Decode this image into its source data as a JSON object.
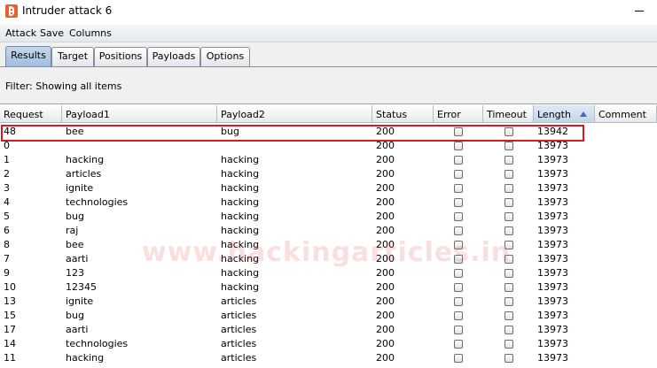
{
  "window": {
    "title": "Intruder attack 6"
  },
  "menu": [
    {
      "label": "Attack"
    },
    {
      "label": "Save"
    },
    {
      "label": "Columns"
    }
  ],
  "tabs": [
    {
      "label": "Results",
      "active": true
    },
    {
      "label": "Target",
      "active": false
    },
    {
      "label": "Positions",
      "active": false
    },
    {
      "label": "Payloads",
      "active": false
    },
    {
      "label": "Options",
      "active": false
    }
  ],
  "filter": {
    "text": "Filter:  Showing all items"
  },
  "table": {
    "columns": [
      "Request",
      "Payload1",
      "Payload2",
      "Status",
      "Error",
      "Timeout",
      "Length",
      "Comment"
    ],
    "sorted_column": "Length",
    "sort_direction": "ascending",
    "rows": [
      {
        "request": "48",
        "payload1": "bee",
        "payload2": "bug",
        "status": "200",
        "error": false,
        "timeout": false,
        "length": "13942",
        "comment": ""
      },
      {
        "request": "0",
        "payload1": "",
        "payload2": "",
        "status": "200",
        "error": false,
        "timeout": false,
        "length": "13973",
        "comment": ""
      },
      {
        "request": "1",
        "payload1": "hacking",
        "payload2": "hacking",
        "status": "200",
        "error": false,
        "timeout": false,
        "length": "13973",
        "comment": ""
      },
      {
        "request": "2",
        "payload1": "articles",
        "payload2": "hacking",
        "status": "200",
        "error": false,
        "timeout": false,
        "length": "13973",
        "comment": ""
      },
      {
        "request": "3",
        "payload1": "ignite",
        "payload2": "hacking",
        "status": "200",
        "error": false,
        "timeout": false,
        "length": "13973",
        "comment": ""
      },
      {
        "request": "4",
        "payload1": "technologies",
        "payload2": "hacking",
        "status": "200",
        "error": false,
        "timeout": false,
        "length": "13973",
        "comment": ""
      },
      {
        "request": "5",
        "payload1": "bug",
        "payload2": "hacking",
        "status": "200",
        "error": false,
        "timeout": false,
        "length": "13973",
        "comment": ""
      },
      {
        "request": "6",
        "payload1": "raj",
        "payload2": "hacking",
        "status": "200",
        "error": false,
        "timeout": false,
        "length": "13973",
        "comment": ""
      },
      {
        "request": "8",
        "payload1": "bee",
        "payload2": "hacking",
        "status": "200",
        "error": false,
        "timeout": false,
        "length": "13973",
        "comment": ""
      },
      {
        "request": "7",
        "payload1": "aarti",
        "payload2": "hacking",
        "status": "200",
        "error": false,
        "timeout": false,
        "length": "13973",
        "comment": ""
      },
      {
        "request": "9",
        "payload1": "123",
        "payload2": "hacking",
        "status": "200",
        "error": false,
        "timeout": false,
        "length": "13973",
        "comment": ""
      },
      {
        "request": "10",
        "payload1": "12345",
        "payload2": "hacking",
        "status": "200",
        "error": false,
        "timeout": false,
        "length": "13973",
        "comment": ""
      },
      {
        "request": "13",
        "payload1": "ignite",
        "payload2": "articles",
        "status": "200",
        "error": false,
        "timeout": false,
        "length": "13973",
        "comment": ""
      },
      {
        "request": "15",
        "payload1": "bug",
        "payload2": "articles",
        "status": "200",
        "error": false,
        "timeout": false,
        "length": "13973",
        "comment": ""
      },
      {
        "request": "17",
        "payload1": "aarti",
        "payload2": "articles",
        "status": "200",
        "error": false,
        "timeout": false,
        "length": "13973",
        "comment": ""
      },
      {
        "request": "14",
        "payload1": "technologies",
        "payload2": "articles",
        "status": "200",
        "error": false,
        "timeout": false,
        "length": "13973",
        "comment": ""
      },
      {
        "request": "11",
        "payload1": "hacking",
        "payload2": "articles",
        "status": "200",
        "error": false,
        "timeout": false,
        "length": "13973",
        "comment": ""
      }
    ]
  },
  "watermark": {
    "text": "www.hackingarticles.in"
  },
  "colors": {
    "highlight": "#d71920",
    "active_tab": "#9ebcdc",
    "sort_arrow": "#3b6fb5"
  }
}
